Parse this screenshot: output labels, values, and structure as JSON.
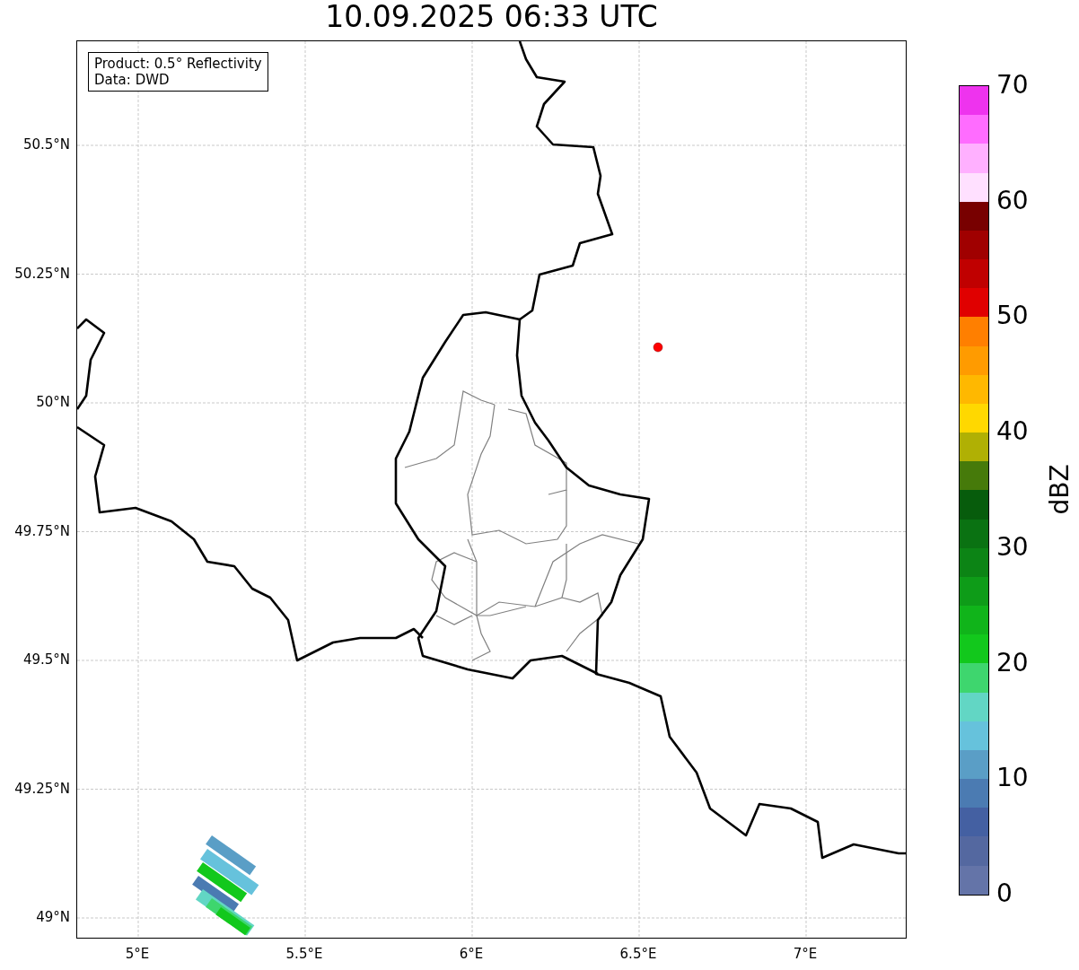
{
  "title": "10.09.2025 06:33 UTC",
  "info_box": [
    "Product: 0.5° Reflectivity",
    "Data: DWD"
  ],
  "map": {
    "lat_labels": [
      "50.5°N",
      "50.25°N",
      "50°N",
      "49.75°N",
      "49.5°N",
      "49.25°N",
      "49°N"
    ],
    "lon_labels": [
      "5°E",
      "5.5°E",
      "6°E",
      "6.5°E",
      "7°E"
    ]
  },
  "colorbar": {
    "label": "dBZ",
    "ticks": [
      "70",
      "60",
      "50",
      "40",
      "30",
      "20",
      "10",
      "0"
    ],
    "segments": [
      {
        "color": "#ee33ee"
      },
      {
        "color": "#ff6cff"
      },
      {
        "color": "#ffb0ff"
      },
      {
        "color": "#ffe0ff"
      },
      {
        "color": "#780000"
      },
      {
        "color": "#a00000"
      },
      {
        "color": "#c00000"
      },
      {
        "color": "#e00000"
      },
      {
        "color": "#ff7f00"
      },
      {
        "color": "#ff9b00"
      },
      {
        "color": "#ffb800"
      },
      {
        "color": "#ffd800"
      },
      {
        "color": "#b0b004"
      },
      {
        "color": "#467a0a"
      },
      {
        "color": "#075c0c"
      },
      {
        "color": "#0a7212"
      },
      {
        "color": "#0c8415"
      },
      {
        "color": "#0e9c18"
      },
      {
        "color": "#10b41a"
      },
      {
        "color": "#12c81c"
      },
      {
        "color": "#3ed66e"
      },
      {
        "color": "#62d6c4"
      },
      {
        "color": "#66c2dc"
      },
      {
        "color": "#5a9ec6"
      },
      {
        "color": "#4b7bb2"
      },
      {
        "color": "#4460a2"
      },
      {
        "color": "#5468a0"
      },
      {
        "color": "#6474a8"
      }
    ]
  }
}
